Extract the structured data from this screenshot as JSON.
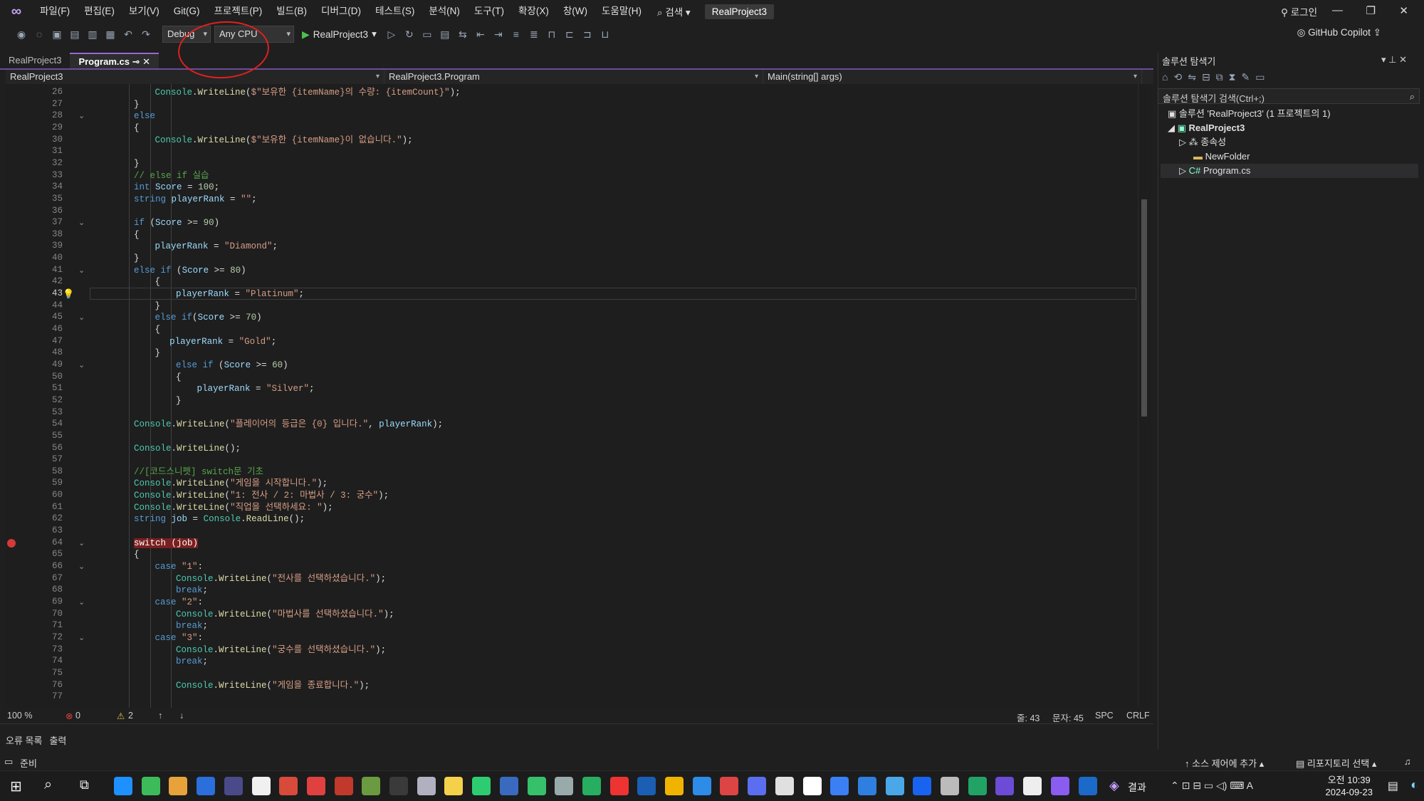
{
  "menubar": {
    "items": [
      "파일(F)",
      "편집(E)",
      "보기(V)",
      "Git(G)",
      "프로젝트(P)",
      "빌드(B)",
      "디버그(D)",
      "테스트(S)",
      "분석(N)",
      "도구(T)",
      "확장(X)",
      "창(W)",
      "도움말(H)"
    ],
    "search": "검색",
    "project_badge": "RealProject3",
    "login": "로그인"
  },
  "toolbar": {
    "config": "Debug",
    "platform": "Any CPU",
    "run_target": "RealProject3",
    "copilot": "GitHub Copilot"
  },
  "tabs": [
    {
      "label": "RealProject3",
      "active": false
    },
    {
      "label": "Program.cs",
      "active": true
    }
  ],
  "navbar": {
    "project": "RealProject3",
    "class": "RealProject3.Program",
    "member": "Main(string[] args)"
  },
  "code": {
    "current_line": 43,
    "breakpoint_line": 64,
    "fold_lines": [
      28,
      37,
      41,
      45,
      49,
      64,
      66,
      69,
      72
    ],
    "lines": [
      {
        "n": 26,
        "indent": 4,
        "t": "Console.WriteLine($\"보유한 {itemName}의 수량: {itemCount}\");"
      },
      {
        "n": 27,
        "indent": 3,
        "t": "}"
      },
      {
        "n": 28,
        "indent": 3,
        "t": "else"
      },
      {
        "n": 29,
        "indent": 3,
        "t": "{"
      },
      {
        "n": 30,
        "indent": 4,
        "t": "Console.WriteLine($\"보유한 {itemName}이 없습니다.\");"
      },
      {
        "n": 31,
        "indent": 3,
        "t": ""
      },
      {
        "n": 32,
        "indent": 3,
        "t": "}"
      },
      {
        "n": 33,
        "indent": 3,
        "t": "// else if 실습"
      },
      {
        "n": 34,
        "indent": 3,
        "t": "int Score = 100;"
      },
      {
        "n": 35,
        "indent": 3,
        "t": "string playerRank = \"\";"
      },
      {
        "n": 36,
        "indent": 3,
        "t": ""
      },
      {
        "n": 37,
        "indent": 3,
        "t": "if (Score >= 90)"
      },
      {
        "n": 38,
        "indent": 3,
        "t": "{"
      },
      {
        "n": 39,
        "indent": 4,
        "t": "playerRank = \"Diamond\";"
      },
      {
        "n": 40,
        "indent": 3,
        "t": "}"
      },
      {
        "n": 41,
        "indent": 3,
        "t": "else if (Score >= 80)"
      },
      {
        "n": 42,
        "indent": 4,
        "t": "{"
      },
      {
        "n": 43,
        "indent": 5,
        "t": "playerRank = \"Platinum\";"
      },
      {
        "n": 44,
        "indent": 4,
        "t": "}"
      },
      {
        "n": 45,
        "indent": 4,
        "t": "else if(Score >= 70)"
      },
      {
        "n": 46,
        "indent": 4,
        "t": "{"
      },
      {
        "n": 47,
        "indent": 4.7,
        "t": "playerRank = \"Gold\";"
      },
      {
        "n": 48,
        "indent": 4,
        "t": "}"
      },
      {
        "n": 49,
        "indent": 5,
        "t": "else if (Score >= 60)"
      },
      {
        "n": 50,
        "indent": 5,
        "t": "{"
      },
      {
        "n": 51,
        "indent": 6,
        "t": "playerRank = \"Silver\";"
      },
      {
        "n": 52,
        "indent": 5,
        "t": "}"
      },
      {
        "n": 53,
        "indent": 3,
        "t": ""
      },
      {
        "n": 54,
        "indent": 3,
        "t": "Console.WriteLine(\"플레이어의 등급은 {0} 입니다.\", playerRank);"
      },
      {
        "n": 55,
        "indent": 3,
        "t": ""
      },
      {
        "n": 56,
        "indent": 3,
        "t": "Console.WriteLine();"
      },
      {
        "n": 57,
        "indent": 3,
        "t": ""
      },
      {
        "n": 58,
        "indent": 3,
        "t": "//[코드스니펫] switch문 기초"
      },
      {
        "n": 59,
        "indent": 3,
        "t": "Console.WriteLine(\"게임을 시작합니다.\");"
      },
      {
        "n": 60,
        "indent": 3,
        "t": "Console.WriteLine(\"1: 전사 / 2: 마법사 / 3: 궁수\");"
      },
      {
        "n": 61,
        "indent": 3,
        "t": "Console.WriteLine(\"직업을 선택하세요: \");"
      },
      {
        "n": 62,
        "indent": 3,
        "t": "string job = Console.ReadLine();"
      },
      {
        "n": 63,
        "indent": 3,
        "t": ""
      },
      {
        "n": 64,
        "indent": 3,
        "t": "switch (job)"
      },
      {
        "n": 65,
        "indent": 3,
        "t": "{"
      },
      {
        "n": 66,
        "indent": 4,
        "t": "case \"1\":"
      },
      {
        "n": 67,
        "indent": 5,
        "t": "Console.WriteLine(\"전사를 선택하셨습니다.\");"
      },
      {
        "n": 68,
        "indent": 5,
        "t": "break;"
      },
      {
        "n": 69,
        "indent": 4,
        "t": "case \"2\":"
      },
      {
        "n": 70,
        "indent": 5,
        "t": "Console.WriteLine(\"마법사를 선택하셨습니다.\");"
      },
      {
        "n": 71,
        "indent": 5,
        "t": "break;"
      },
      {
        "n": 72,
        "indent": 4,
        "t": "case \"3\":"
      },
      {
        "n": 73,
        "indent": 5,
        "t": "Console.WriteLine(\"궁수를 선택하셨습니다.\");"
      },
      {
        "n": 74,
        "indent": 5,
        "t": "break;"
      },
      {
        "n": 75,
        "indent": 4,
        "t": ""
      },
      {
        "n": 76,
        "indent": 5,
        "t": "Console.WriteLine(\"게임을 종료합니다.\");"
      },
      {
        "n": 77,
        "indent": 4,
        "t": ""
      }
    ]
  },
  "status_line": {
    "zoom": "100 %",
    "errors": "0",
    "warnings": "2",
    "line": "줄: 43",
    "col": "문자: 45",
    "spc": "SPC",
    "crlf": "CRLF"
  },
  "bottom_tabs": [
    "오류 목록",
    "출력"
  ],
  "solution_explorer": {
    "title": "솔루션 탐색기",
    "search_placeholder": "솔루션 탐색기 검색(Ctrl+;)",
    "solution": "솔루션 'RealProject3' (1 프로젝트의 1)",
    "project": "RealProject3",
    "items": [
      "종속성",
      "NewFolder",
      "Program.cs"
    ]
  },
  "statusbar": {
    "ready": "준비",
    "source_control": "소스 제어에 추가",
    "repo": "리포지토리 선택"
  },
  "taskbar": {
    "result": "결과",
    "time": "오전 10:39",
    "date": "2024-09-23"
  },
  "colors": {
    "accent": "#9a67d6",
    "breakpoint": "#d33a3a",
    "annotation": "#e02020"
  }
}
